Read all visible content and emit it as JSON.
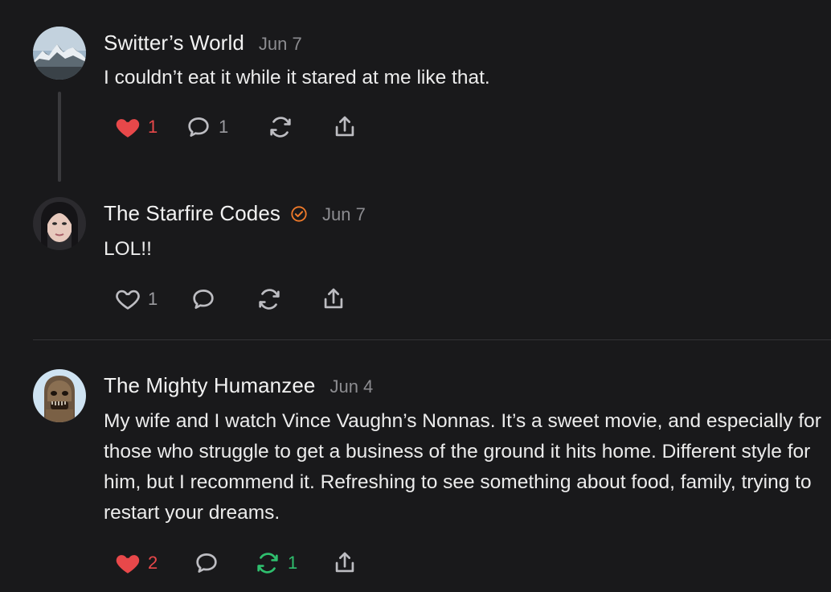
{
  "comments": [
    {
      "author": "Switter’s World",
      "date": "Jun 7",
      "text": "I couldn’t eat it while it stared at me like that.",
      "avatar_icon": "mountain-avatar",
      "likes": "1",
      "replies": "1",
      "restacks": "",
      "liked": true
    },
    {
      "author": "The Starfire Codes",
      "verified_icon": "verified-badge-icon",
      "date": "Jun 7",
      "text": "LOL!!",
      "avatar_icon": "portrait-avatar",
      "likes": "1",
      "replies": "",
      "restacks": "",
      "liked": false
    },
    {
      "author": "The Mighty Humanzee",
      "date": "Jun 4",
      "text": "My wife and I watch Vince Vaughn’s Nonnas. It’s a sweet movie, and especially for those who struggle to get a business of the ground it hits home. Different style for him, but I recommend it. Refreshing to see something about food, family, trying to restart your dreams.",
      "avatar_icon": "creature-avatar",
      "likes": "2",
      "replies": "",
      "restacks": "1",
      "liked": true,
      "restacked": true
    }
  ],
  "colors": {
    "background": "#19191b",
    "like_active": "#e8484a",
    "restack_active": "#2fbf6e",
    "verified": "#f07a2a",
    "muted": "#8c8c90"
  }
}
